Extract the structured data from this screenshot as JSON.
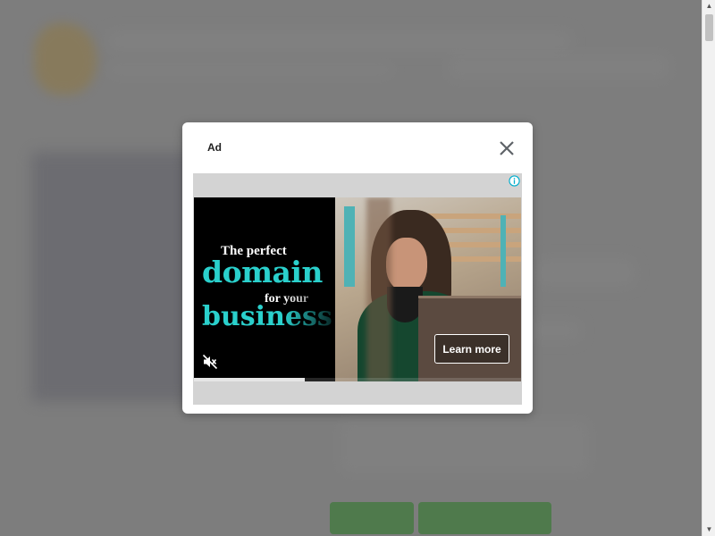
{
  "modal": {
    "title": "Ad",
    "close_icon": "close-icon"
  },
  "ad": {
    "adchoices_icon": "info-icon",
    "headline_line1": "The perfect",
    "headline_line2": "domain",
    "headline_line3": "for your",
    "headline_line4": "business",
    "cta_label": "Learn more",
    "mute_icon": "volume-muted-icon",
    "video_progress": 0.34,
    "accent_color": "#2ad0cc"
  },
  "background_page": {
    "buttons_color": "#4f7a4c"
  }
}
